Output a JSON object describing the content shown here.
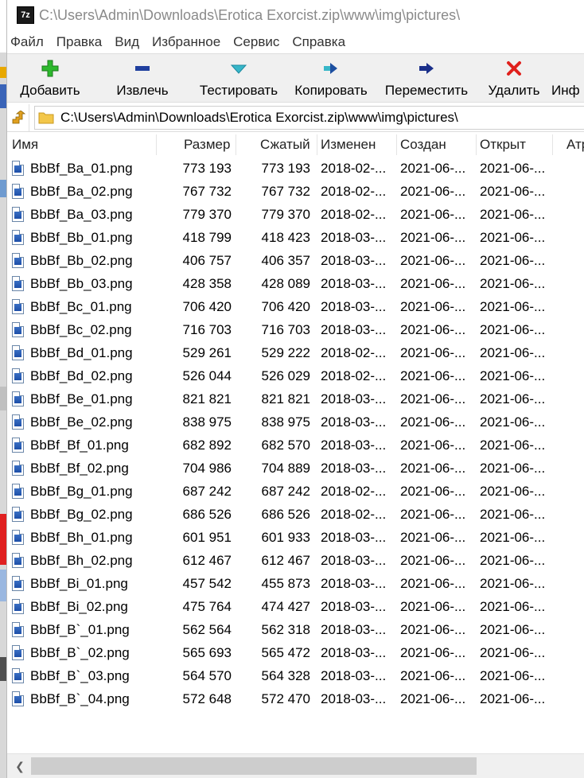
{
  "window": {
    "title": "C:\\Users\\Admin\\Downloads\\Erotica Exorcist.zip\\www\\img\\pictures\\",
    "app_icon_label": "7z"
  },
  "menu": [
    "Файл",
    "Правка",
    "Вид",
    "Избранное",
    "Сервис",
    "Справка"
  ],
  "toolbar": {
    "add_label": "Добавить",
    "extract_label": "Извлечь",
    "test_label": "Тестировать",
    "copy_label": "Копировать",
    "move_label": "Переместить",
    "delete_label": "Удалить",
    "info_label": "Инф"
  },
  "address": {
    "path": "C:\\Users\\Admin\\Downloads\\Erotica Exorcist.zip\\www\\img\\pictures\\"
  },
  "columns": [
    "Имя",
    "Размер",
    "Сжатый",
    "Изменен",
    "Создан",
    "Открыт",
    "Атр"
  ],
  "files": [
    {
      "name": "BbBf_Ba_01.png",
      "size": "773 193",
      "packed": "773 193",
      "modified": "2018-02-...",
      "created": "2021-06-...",
      "accessed": "2021-06-..."
    },
    {
      "name": "BbBf_Ba_02.png",
      "size": "767 732",
      "packed": "767 732",
      "modified": "2018-02-...",
      "created": "2021-06-...",
      "accessed": "2021-06-..."
    },
    {
      "name": "BbBf_Ba_03.png",
      "size": "779 370",
      "packed": "779 370",
      "modified": "2018-02-...",
      "created": "2021-06-...",
      "accessed": "2021-06-..."
    },
    {
      "name": "BbBf_Bb_01.png",
      "size": "418 799",
      "packed": "418 423",
      "modified": "2018-03-...",
      "created": "2021-06-...",
      "accessed": "2021-06-..."
    },
    {
      "name": "BbBf_Bb_02.png",
      "size": "406 757",
      "packed": "406 357",
      "modified": "2018-03-...",
      "created": "2021-06-...",
      "accessed": "2021-06-..."
    },
    {
      "name": "BbBf_Bb_03.png",
      "size": "428 358",
      "packed": "428 089",
      "modified": "2018-03-...",
      "created": "2021-06-...",
      "accessed": "2021-06-..."
    },
    {
      "name": "BbBf_Bc_01.png",
      "size": "706 420",
      "packed": "706 420",
      "modified": "2018-03-...",
      "created": "2021-06-...",
      "accessed": "2021-06-..."
    },
    {
      "name": "BbBf_Bc_02.png",
      "size": "716 703",
      "packed": "716 703",
      "modified": "2018-03-...",
      "created": "2021-06-...",
      "accessed": "2021-06-..."
    },
    {
      "name": "BbBf_Bd_01.png",
      "size": "529 261",
      "packed": "529 222",
      "modified": "2018-02-...",
      "created": "2021-06-...",
      "accessed": "2021-06-..."
    },
    {
      "name": "BbBf_Bd_02.png",
      "size": "526 044",
      "packed": "526 029",
      "modified": "2018-02-...",
      "created": "2021-06-...",
      "accessed": "2021-06-..."
    },
    {
      "name": "BbBf_Be_01.png",
      "size": "821 821",
      "packed": "821 821",
      "modified": "2018-03-...",
      "created": "2021-06-...",
      "accessed": "2021-06-..."
    },
    {
      "name": "BbBf_Be_02.png",
      "size": "838 975",
      "packed": "838 975",
      "modified": "2018-03-...",
      "created": "2021-06-...",
      "accessed": "2021-06-..."
    },
    {
      "name": "BbBf_Bf_01.png",
      "size": "682 892",
      "packed": "682 570",
      "modified": "2018-03-...",
      "created": "2021-06-...",
      "accessed": "2021-06-..."
    },
    {
      "name": "BbBf_Bf_02.png",
      "size": "704 986",
      "packed": "704 889",
      "modified": "2018-03-...",
      "created": "2021-06-...",
      "accessed": "2021-06-..."
    },
    {
      "name": "BbBf_Bg_01.png",
      "size": "687 242",
      "packed": "687 242",
      "modified": "2018-02-...",
      "created": "2021-06-...",
      "accessed": "2021-06-..."
    },
    {
      "name": "BbBf_Bg_02.png",
      "size": "686 526",
      "packed": "686 526",
      "modified": "2018-02-...",
      "created": "2021-06-...",
      "accessed": "2021-06-..."
    },
    {
      "name": "BbBf_Bh_01.png",
      "size": "601 951",
      "packed": "601 933",
      "modified": "2018-03-...",
      "created": "2021-06-...",
      "accessed": "2021-06-..."
    },
    {
      "name": "BbBf_Bh_02.png",
      "size": "612 467",
      "packed": "612 467",
      "modified": "2018-03-...",
      "created": "2021-06-...",
      "accessed": "2021-06-..."
    },
    {
      "name": "BbBf_Bi_01.png",
      "size": "457 542",
      "packed": "455 873",
      "modified": "2018-03-...",
      "created": "2021-06-...",
      "accessed": "2021-06-..."
    },
    {
      "name": "BbBf_Bi_02.png",
      "size": "475 764",
      "packed": "474 427",
      "modified": "2018-03-...",
      "created": "2021-06-...",
      "accessed": "2021-06-..."
    },
    {
      "name": "BbBf_B`_01.png",
      "size": "562 564",
      "packed": "562 318",
      "modified": "2018-03-...",
      "created": "2021-06-...",
      "accessed": "2021-06-..."
    },
    {
      "name": "BbBf_B`_02.png",
      "size": "565 693",
      "packed": "565 472",
      "modified": "2018-03-...",
      "created": "2021-06-...",
      "accessed": "2021-06-..."
    },
    {
      "name": "BbBf_B`_03.png",
      "size": "564 570",
      "packed": "564 328",
      "modified": "2018-03-...",
      "created": "2021-06-...",
      "accessed": "2021-06-..."
    },
    {
      "name": "BbBf_B`_04.png",
      "size": "572 648",
      "packed": "572 470",
      "modified": "2018-03-...",
      "created": "2021-06-...",
      "accessed": "2021-06-..."
    }
  ],
  "colors": {
    "add": "#2db82d",
    "extract": "#1f3f9e",
    "test": "#37b6c8",
    "copy": "#1c4fa0",
    "move": "#1a2f8a",
    "delete": "#e0201c"
  }
}
